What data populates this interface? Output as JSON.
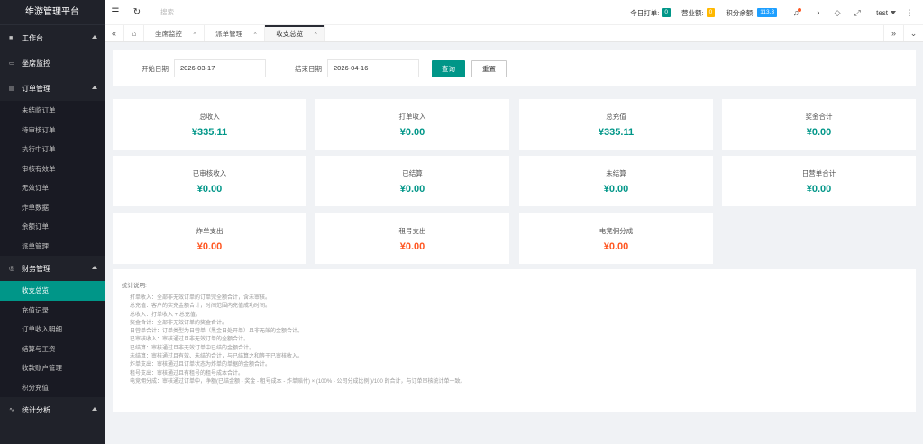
{
  "app_title": "维游管理平台",
  "sidebar": {
    "groups": [
      {
        "label": "工作台",
        "items": []
      },
      {
        "label": "坐席监控",
        "items": []
      },
      {
        "label": "订单管理",
        "items": [
          "未结临订单",
          "待审核订单",
          "执行中订单",
          "审核有效单",
          "无效订单",
          "炸单数据",
          "余额订单",
          "派单管理"
        ]
      },
      {
        "label": "财务管理",
        "items": [
          "收支总览",
          "充值记录",
          "订单收入明细",
          "结算与工资",
          "收款账户管理",
          "积分充值"
        ]
      },
      {
        "label": "统计分析",
        "items": []
      }
    ],
    "active_item": "收支总览"
  },
  "header": {
    "search_placeholder": "搜索...",
    "stats": [
      {
        "label": "今日打单:",
        "value": "0",
        "color": "#009688"
      },
      {
        "label": "营业额:",
        "value": "0",
        "color": "#ffb800"
      },
      {
        "label": "积分余额:",
        "value": "113.3",
        "color": "#1e9fff"
      }
    ],
    "username": "test"
  },
  "tabs": [
    {
      "label": "坐席监控",
      "active": false
    },
    {
      "label": "派单管理",
      "active": false
    },
    {
      "label": "收支总览",
      "active": true
    }
  ],
  "filter": {
    "start_label": "开始日期",
    "start_value": "2026-03-17",
    "end_label": "结束日期",
    "end_value": "2026-04-16",
    "query_button": "查询",
    "reset_button": "重置"
  },
  "cards": [
    {
      "label": "总收入",
      "value": "¥335.11",
      "tone": "green"
    },
    {
      "label": "打单收入",
      "value": "¥0.00",
      "tone": "green"
    },
    {
      "label": "总充值",
      "value": "¥335.11",
      "tone": "green"
    },
    {
      "label": "奖金合计",
      "value": "¥0.00",
      "tone": "green"
    },
    {
      "label": "已审核收入",
      "value": "¥0.00",
      "tone": "green"
    },
    {
      "label": "已结算",
      "value": "¥0.00",
      "tone": "green"
    },
    {
      "label": "未结算",
      "value": "¥0.00",
      "tone": "green"
    },
    {
      "label": "日营单合计",
      "value": "¥0.00",
      "tone": "green"
    },
    {
      "label": "炸单支出",
      "value": "¥0.00",
      "tone": "red"
    },
    {
      "label": "租号支出",
      "value": "¥0.00",
      "tone": "red"
    },
    {
      "label": "电竞佣分成",
      "value": "¥0.00",
      "tone": "red"
    }
  ],
  "notes": {
    "title": "统计说明:",
    "lines": [
      "打单收入：全部非无效订单的订单完全额合计，含未审核。",
      "总充值：客户的实充金额合计，时间范围内充值成功时间。",
      "总收入：打单收入 + 总充值。",
      "奖金合计：全部非无效订单的奖金合计。",
      "日营单合计：订单类型为日营单（黑金日处开单）且非无效的金额合计。",
      "已审核收入：审核通过且非无效订单的全额合计。",
      "已结算：审核通过且非无效订单中已结的金额合计。",
      "未结算：审核通过且有效、未结的合计，与已结算之和等于已审核收入。",
      "炸单支出：审核通过且订单状态为炸单的单据的金额合计。",
      "租号支出：审核通过且有租号的租号成本合计。",
      "电竞佣分成：审核通过订单中，净额(已结金额 - 奖金 - 租号成本 - 炸单赔付) × (100% - 公司分成比例 )/100 的合计，与订单审核统计单一致。"
    ]
  }
}
